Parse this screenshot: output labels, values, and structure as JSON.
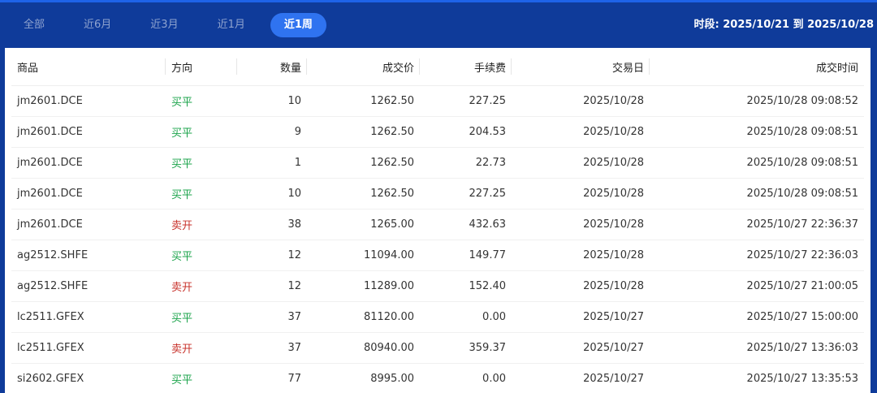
{
  "tabs": [
    {
      "label": "全部",
      "active": false
    },
    {
      "label": "近6月",
      "active": false
    },
    {
      "label": "近3月",
      "active": false
    },
    {
      "label": "近1月",
      "active": false
    },
    {
      "label": "近1周",
      "active": true
    }
  ],
  "period_text": "时段: 2025/10/21 到 2025/10/28",
  "colors": {
    "buy": "#1aa34a",
    "sell": "#c8332c",
    "active_tab": "#2f73f0",
    "header_bg": "#0f3b9a"
  },
  "table": {
    "headers": [
      "商品",
      "方向",
      "数量",
      "成交价",
      "手续费",
      "交易日",
      "成交时间"
    ],
    "rows": [
      {
        "product": "jm2601.DCE",
        "direction": "买平",
        "side": "buy",
        "qty": "10",
        "price": "1262.50",
        "fee": "227.25",
        "trade_day": "2025/10/28",
        "time": "2025/10/28 09:08:52"
      },
      {
        "product": "jm2601.DCE",
        "direction": "买平",
        "side": "buy",
        "qty": "9",
        "price": "1262.50",
        "fee": "204.53",
        "trade_day": "2025/10/28",
        "time": "2025/10/28 09:08:51"
      },
      {
        "product": "jm2601.DCE",
        "direction": "买平",
        "side": "buy",
        "qty": "1",
        "price": "1262.50",
        "fee": "22.73",
        "trade_day": "2025/10/28",
        "time": "2025/10/28 09:08:51"
      },
      {
        "product": "jm2601.DCE",
        "direction": "买平",
        "side": "buy",
        "qty": "10",
        "price": "1262.50",
        "fee": "227.25",
        "trade_day": "2025/10/28",
        "time": "2025/10/28 09:08:51"
      },
      {
        "product": "jm2601.DCE",
        "direction": "卖开",
        "side": "sell",
        "qty": "38",
        "price": "1265.00",
        "fee": "432.63",
        "trade_day": "2025/10/28",
        "time": "2025/10/27 22:36:37"
      },
      {
        "product": "ag2512.SHFE",
        "direction": "买平",
        "side": "buy",
        "qty": "12",
        "price": "11094.00",
        "fee": "149.77",
        "trade_day": "2025/10/28",
        "time": "2025/10/27 22:36:03"
      },
      {
        "product": "ag2512.SHFE",
        "direction": "卖开",
        "side": "sell",
        "qty": "12",
        "price": "11289.00",
        "fee": "152.40",
        "trade_day": "2025/10/28",
        "time": "2025/10/27 21:00:05"
      },
      {
        "product": "lc2511.GFEX",
        "direction": "买平",
        "side": "buy",
        "qty": "37",
        "price": "81120.00",
        "fee": "0.00",
        "trade_day": "2025/10/27",
        "time": "2025/10/27 15:00:00"
      },
      {
        "product": "lc2511.GFEX",
        "direction": "卖开",
        "side": "sell",
        "qty": "37",
        "price": "80940.00",
        "fee": "359.37",
        "trade_day": "2025/10/27",
        "time": "2025/10/27 13:36:03"
      },
      {
        "product": "si2602.GFEX",
        "direction": "买平",
        "side": "buy",
        "qty": "77",
        "price": "8995.00",
        "fee": "0.00",
        "trade_day": "2025/10/27",
        "time": "2025/10/27 13:35:53"
      }
    ]
  }
}
